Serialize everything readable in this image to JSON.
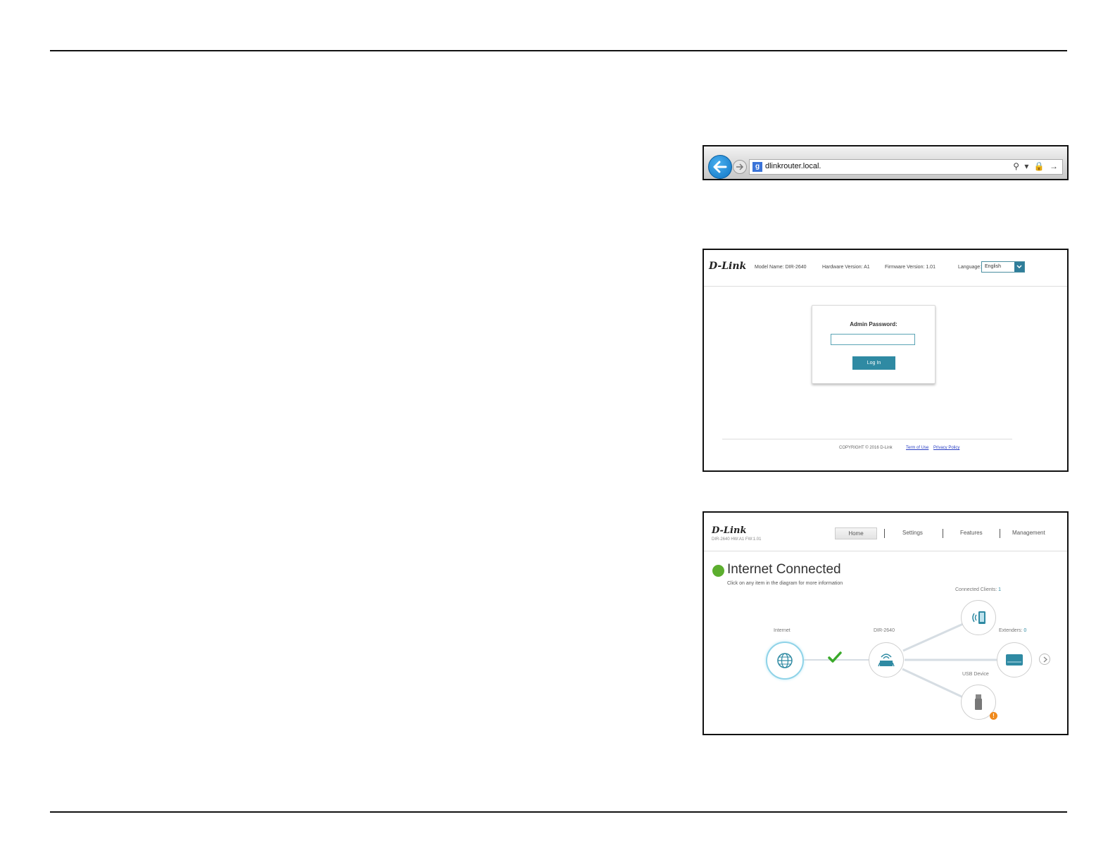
{
  "browser": {
    "url": "dlinkrouter.local.",
    "search_glyph": "⚲",
    "tool_glyphs": "▾ 🔒 →"
  },
  "login": {
    "model_name": "Model Name: DIR-2640",
    "hardware_version": "Hardware Version: A1",
    "firmware_version": "Firmware Version: 1.01",
    "language_label": "Language:",
    "language_value": "English",
    "password_label": "Admin Password:",
    "login_button": "Log In",
    "copyright": "COPYRIGHT © 2016 D-Link",
    "terms_link": "Term of Use",
    "privacy_link": "Privacy Policy"
  },
  "brand": {
    "logo_text": "D-Link"
  },
  "home": {
    "subtitle": "DIR-2640 HW:A1 FW:1.01",
    "nav": {
      "home": "Home",
      "settings": "Settings",
      "features": "Features",
      "management": "Management"
    },
    "status_title": "Internet Connected",
    "status_hint": "Click on any item in the diagram for more information",
    "diagram": {
      "internet_label": "Internet",
      "router_label": "DIR-2640",
      "clients_label": "Connected Clients:",
      "clients_count": "1",
      "extenders_label": "Extenders:",
      "extenders_count": "0",
      "usb_label": "USB Device",
      "usb_warning": "!"
    }
  },
  "colors": {
    "accent": "#2f8aa3",
    "status_ok": "#5cae2e",
    "warning": "#f08a1d",
    "browser_back": "#1a84d8"
  }
}
